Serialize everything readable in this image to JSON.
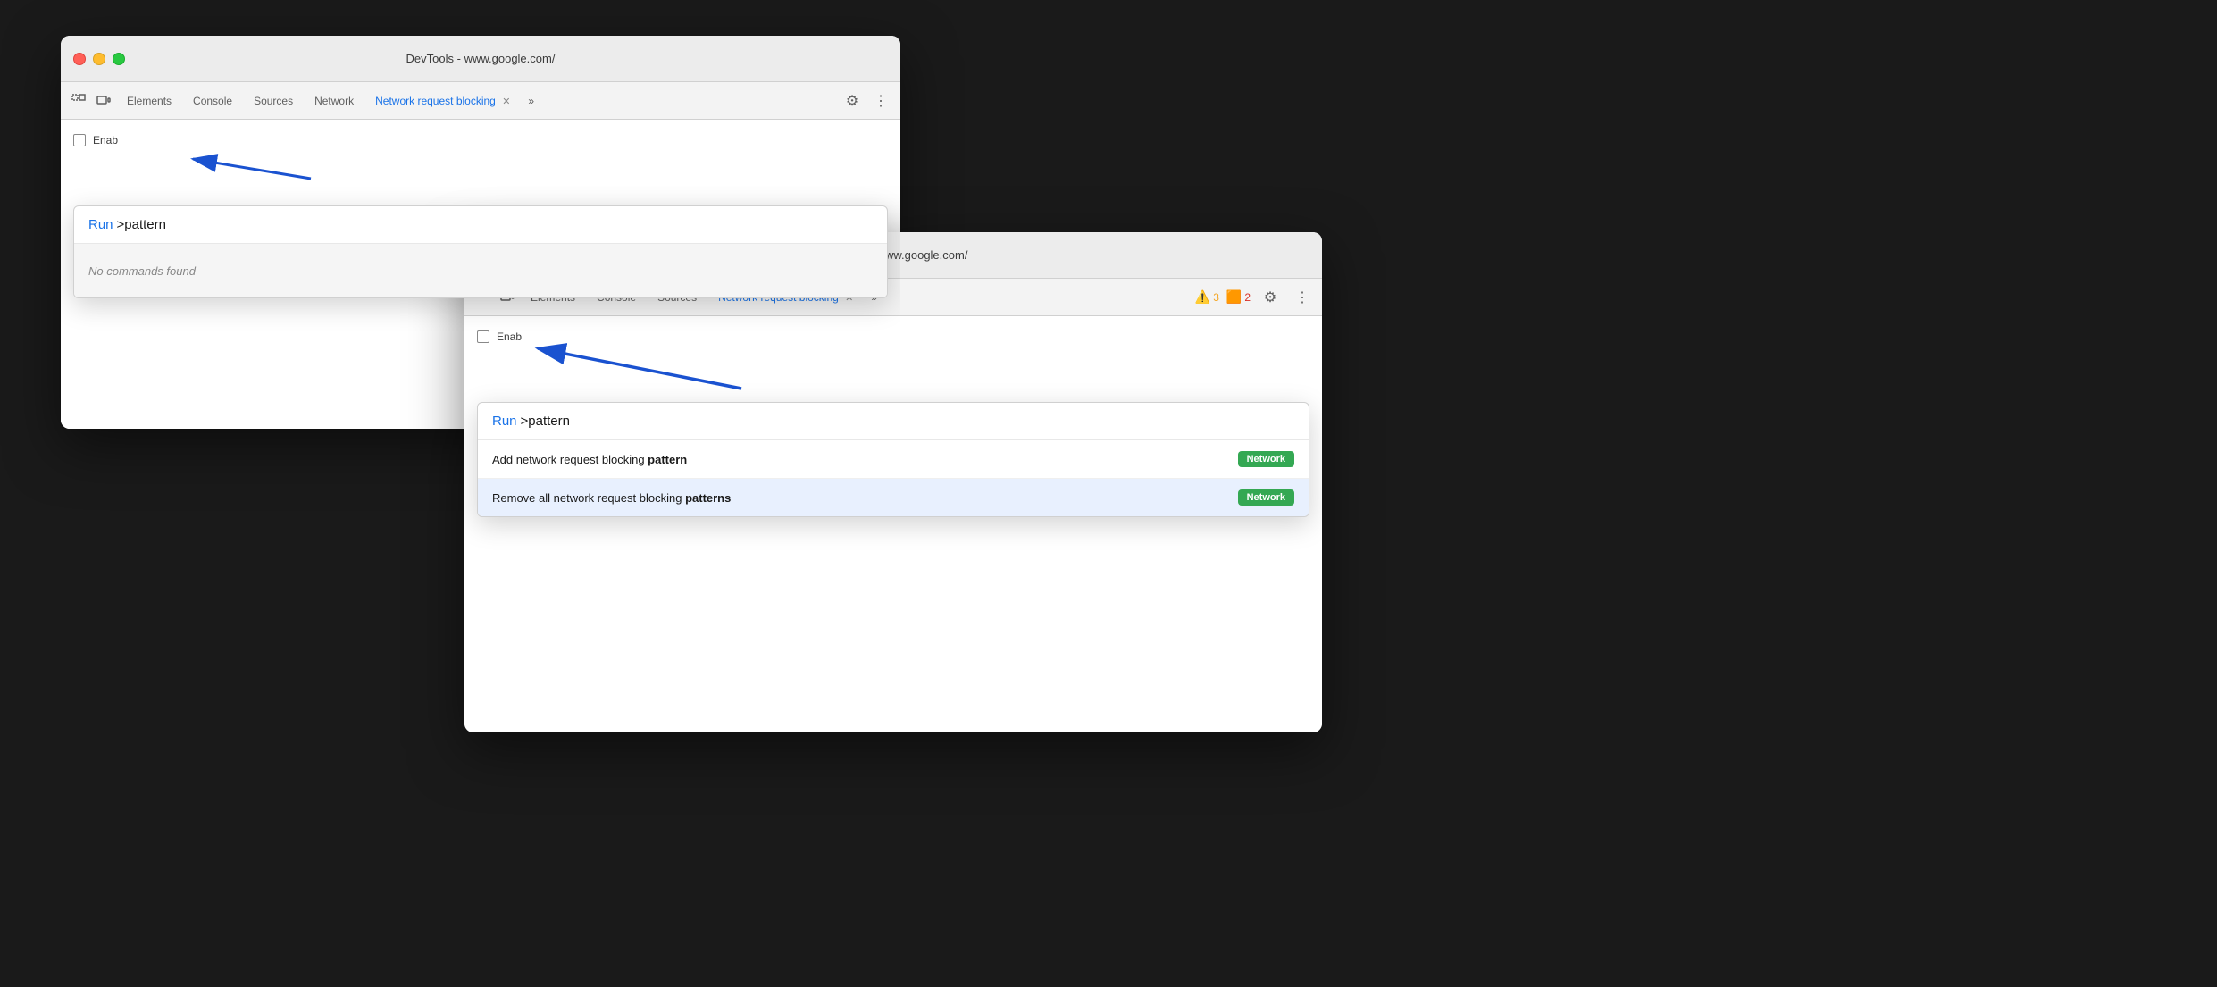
{
  "window1": {
    "title": "DevTools - www.google.com/",
    "tabs": [
      {
        "label": "Elements",
        "active": false
      },
      {
        "label": "Console",
        "active": false
      },
      {
        "label": "Sources",
        "active": false
      },
      {
        "label": "Network",
        "active": false
      },
      {
        "label": "Network request blocking",
        "active": true
      }
    ],
    "enable_label": "Enab",
    "command_palette": {
      "run_label": "Run",
      "input_text": ">pattern",
      "no_results": "No commands found"
    }
  },
  "window2": {
    "title": "DevTools - www.google.com/",
    "tabs": [
      {
        "label": "Elements",
        "active": false
      },
      {
        "label": "Console",
        "active": false
      },
      {
        "label": "Sources",
        "active": false
      },
      {
        "label": "Network request blocking",
        "active": true
      }
    ],
    "warning_count": "3",
    "error_count": "2",
    "enable_label": "Enab",
    "command_palette": {
      "run_label": "Run",
      "input_text": ">pattern",
      "results": [
        {
          "text_prefix": "Add network request blocking ",
          "text_bold": "pattern",
          "text_suffix": "",
          "badge": "Network",
          "highlighted": false
        },
        {
          "text_prefix": "Remove all network request blocking ",
          "text_bold": "patterns",
          "text_suffix": "",
          "badge": "Network",
          "highlighted": true
        }
      ]
    }
  },
  "arrow": {
    "description": "Arrow pointing from command palette input to tab icon"
  },
  "colors": {
    "active_tab": "#1a73e8",
    "badge_green": "#34a853",
    "run_blue": "#1a73e8"
  }
}
